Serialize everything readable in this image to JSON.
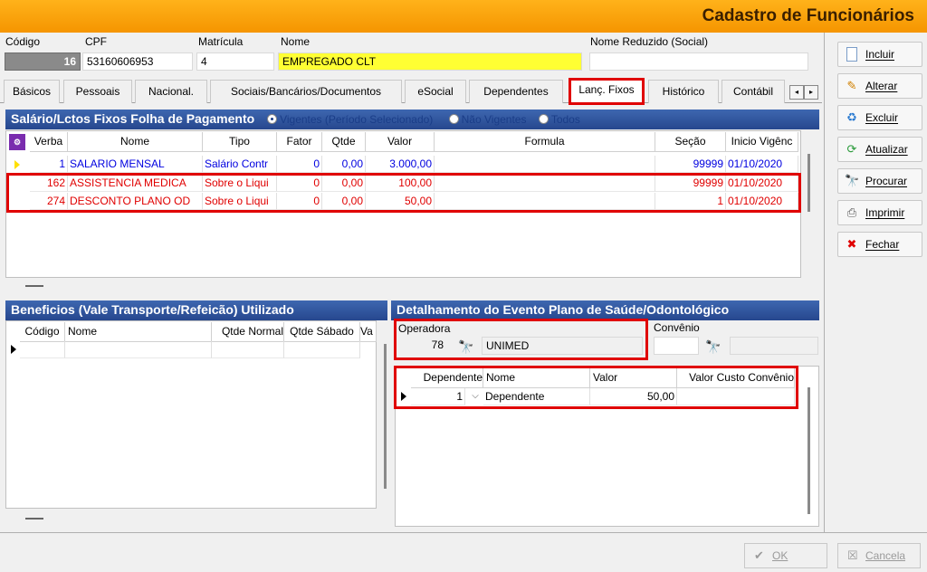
{
  "window": {
    "title": "Cadastro de Funcionários"
  },
  "header": {
    "codigo_label": "Código",
    "codigo_value": "16",
    "cpf_label": "CPF",
    "cpf_value": "53160606953",
    "matricula_label": "Matrícula",
    "matricula_value": "4",
    "nome_label": "Nome",
    "nome_value": "EMPREGADO CLT",
    "nome_reduzido_label": "Nome Reduzido (Social)",
    "nome_reduzido_value": ""
  },
  "tabs": [
    {
      "label": "Básicos"
    },
    {
      "label": "Pessoais"
    },
    {
      "label": "Nacional."
    },
    {
      "label": "Sociais/Bancários/Documentos"
    },
    {
      "label": "eSocial"
    },
    {
      "label": "Dependentes"
    },
    {
      "label": "Lanç. Fixos"
    },
    {
      "label": "Histórico"
    },
    {
      "label": "Contábil"
    }
  ],
  "tab_nav": {
    "prev": "◂",
    "next": "▸"
  },
  "salario": {
    "title": "Salário/Lctos Fixos Folha de Pagamento",
    "radio_vigentes": "Vigentes (Período Selecionado)",
    "radio_nao_vigentes": "Não Vigentes",
    "radio_todos": "Todos",
    "columns": [
      "Verba",
      "Nome",
      "Tipo",
      "Fator",
      "Qtde",
      "Valor",
      "Formula",
      "Seção",
      "Inicio Vigênc"
    ],
    "rows": [
      {
        "verba": "1",
        "nome": "SALARIO MENSAL",
        "tipo": "Salário Contr",
        "fator": "0",
        "qtde": "0,00",
        "valor": "3.000,00",
        "formula": "",
        "secao": "99999",
        "inicio": "01/10/2020",
        "color": "blue"
      },
      {
        "verba": "162",
        "nome": "ASSISTENCIA MEDICA",
        "tipo": "Sobre o Liqui",
        "fator": "0",
        "qtde": "0,00",
        "valor": "100,00",
        "formula": "",
        "secao": "99999",
        "inicio": "01/10/2020",
        "color": "red"
      },
      {
        "verba": "274",
        "nome": "DESCONTO PLANO OD",
        "tipo": "Sobre o Liqui",
        "fator": "0",
        "qtde": "0,00",
        "valor": "50,00",
        "formula": "",
        "secao": "1",
        "inicio": "01/10/2020",
        "color": "red"
      }
    ]
  },
  "beneficios": {
    "title": "Beneficios (Vale Transporte/Refeicão) Utilizado",
    "columns": [
      "Código",
      "Nome",
      "Qtde Normal",
      "Qtde Sábado",
      "Va"
    ]
  },
  "plano": {
    "title": "Detalhamento do Evento Plano de Saúde/Odontológico",
    "operadora_label": "Operadora",
    "operadora_code": "78",
    "operadora_name": "UNIMED",
    "convenio_label": "Convênio",
    "convenio_code": "",
    "convenio_name": "",
    "columns": [
      "Dependente",
      "Nome",
      "Valor",
      "Valor Custo Convênio"
    ],
    "rows": [
      {
        "dependente": "1",
        "nome": "Dependente",
        "valor": "50,00",
        "custo": ""
      }
    ]
  },
  "sidebar": {
    "incluir": "Incluir",
    "alterar": "Alterar",
    "excluir": "Excluir",
    "atualizar": "Atualizar",
    "procurar": "Procurar",
    "imprimir": "Imprimir",
    "fechar": "Fechar"
  },
  "footer": {
    "ok": "OK",
    "cancela": "Cancela"
  }
}
